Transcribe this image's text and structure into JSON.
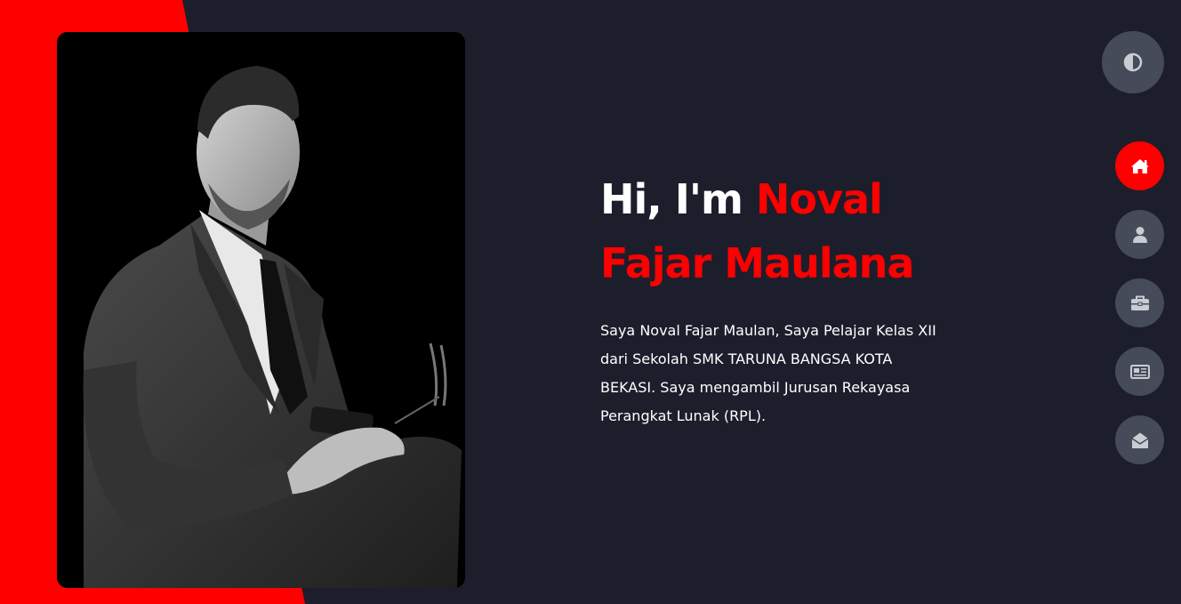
{
  "hero": {
    "greeting": "Hi, I'm ",
    "name_first": "Noval",
    "name_rest": "Fajar Maulana",
    "description": "Saya Noval Fajar Maulan, Saya Pelajar Kelas XII dari Sekolah SMK TARUNA BANGSA KOTA BEKASI. Saya mengambil Jurusan Rekayasa Perangkat Lunak (RPL)."
  },
  "theme_toggle": {
    "icon": "contrast-icon"
  },
  "nav": {
    "items": [
      {
        "id": "home",
        "icon": "home-icon",
        "active": true
      },
      {
        "id": "about",
        "icon": "user-icon",
        "active": false
      },
      {
        "id": "portfolio",
        "icon": "briefcase-icon",
        "active": false
      },
      {
        "id": "blog",
        "icon": "newspaper-icon",
        "active": false
      },
      {
        "id": "contact",
        "icon": "envelope-open-icon",
        "active": false
      }
    ]
  },
  "colors": {
    "background": "#1c1e2c",
    "accent": "#ff0000",
    "button": "#454b58",
    "icon": "#c9ccd3",
    "text": "#ffffff"
  }
}
